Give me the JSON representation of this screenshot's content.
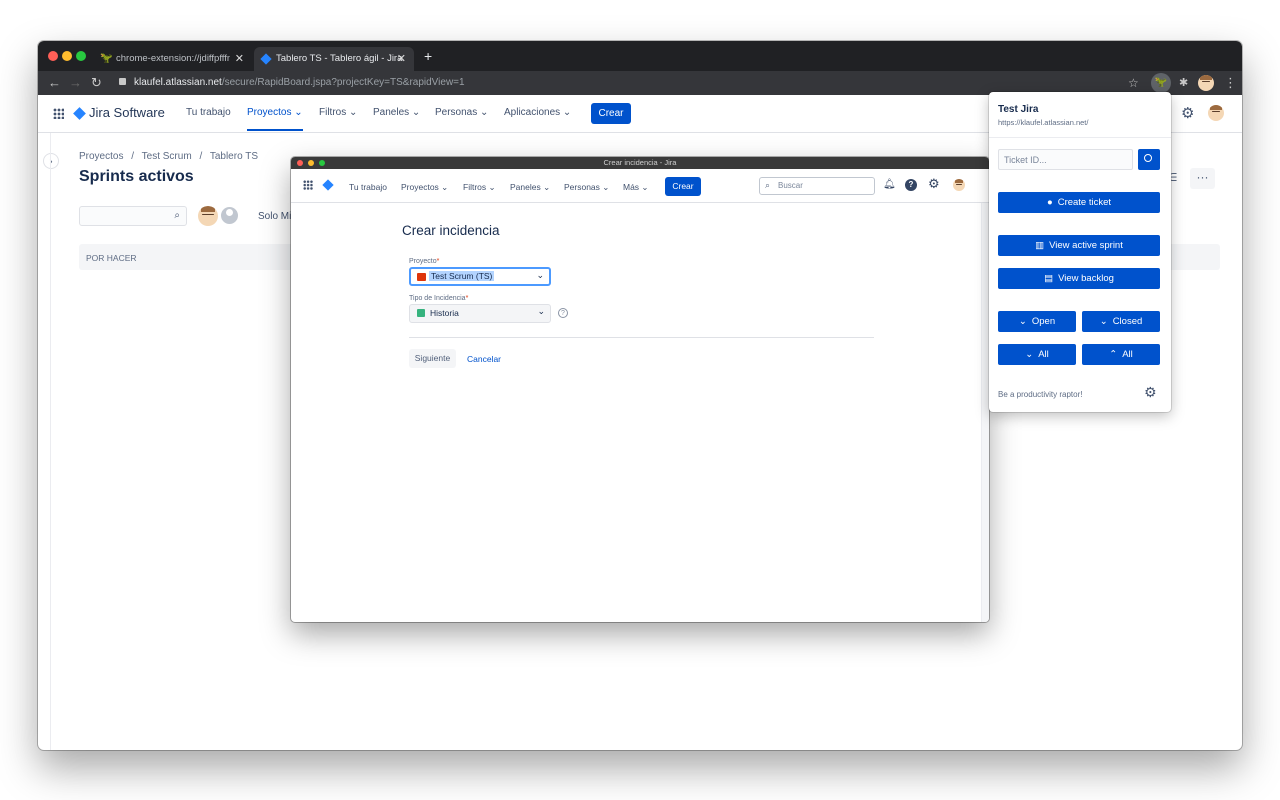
{
  "browser": {
    "tabs": [
      {
        "title": "chrome-extension://jdiffpfffme",
        "icon": "raptor-icon"
      },
      {
        "title": "Tablero TS - Tablero ágil - Jira",
        "icon": "jira-icon"
      }
    ],
    "new_tab": "+",
    "url_host": "klaufel.atlassian.net",
    "url_path": "/secure/RapidBoard.jspa?projectKey=TS&rapidView=1"
  },
  "jira": {
    "product": "Jira Software",
    "nav": [
      "Tu trabajo",
      "Proyectos",
      "Filtros",
      "Paneles",
      "Personas",
      "Aplicaciones"
    ],
    "create": "Crear",
    "breadcrumb": [
      "Proyectos",
      "Test Scrum",
      "Tablero TS"
    ],
    "breadcrumb_sep": "/",
    "page_title": "Sprints activos",
    "filter_text": "Solo Mi",
    "column_header": "POR HACER"
  },
  "modal": {
    "window_title": "Crear incidencia - Jira",
    "nav": [
      "Tu trabajo",
      "Proyectos",
      "Filtros",
      "Paneles",
      "Personas",
      "Más"
    ],
    "create": "Crear",
    "search_placeholder": "Buscar",
    "heading": "Crear incidencia",
    "project_label": "Proyecto",
    "project_value": "Test Scrum (TS)",
    "type_label": "Tipo de Incidencia",
    "type_value": "Historia",
    "required_mark": "*",
    "next": "Siguiente",
    "cancel": "Cancelar"
  },
  "popup": {
    "title": "Test Jira",
    "url": "https://klaufel.atlassian.net/",
    "ticket_placeholder": "Ticket ID...",
    "create_ticket": "Create ticket",
    "view_sprint": "View active sprint",
    "view_backlog": "View backlog",
    "open": "Open",
    "closed": "Closed",
    "all": "All",
    "footer": "Be a productivity raptor!"
  },
  "colors": {
    "primary": "#0052cc",
    "chrome_dark": "#202124",
    "chrome_mid": "#35363a"
  }
}
